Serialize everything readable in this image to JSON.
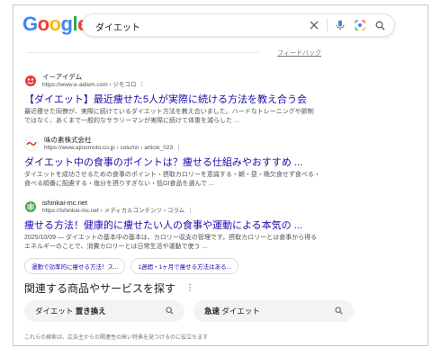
{
  "logo": {
    "letters": [
      "G",
      "o",
      "o",
      "g",
      "l",
      "e"
    ],
    "colors": [
      "#4285F4",
      "#EA4335",
      "#FBBC05",
      "#4285F4",
      "#34A853",
      "#EA4335"
    ]
  },
  "search": {
    "query": "ダイエット"
  },
  "feedback": "フィードバック",
  "results": [
    {
      "site_name": "イーアイデム",
      "url": "https://www.e-aidem.com › ジモコロ",
      "title": "【ダイエット】最近痩せた5人が実際に続ける方法を教え合う会",
      "snippet_1": "最近痩せた同僚が、実際に続けているダイエット方法を教え合いました。ハードなトレーニングや節制",
      "snippet_2": "ではなく、あくまで一般的なサラリーマンが実際に続けて体重を減らした ...",
      "favicon_color": "#e53935"
    },
    {
      "site_name": "味の素株式会社",
      "url": "https://www.ajinomoto.co.jp › column › article_023",
      "title": "ダイエット中の食事のポイントは？痩せる仕組みやおすすめ ...",
      "snippet_1": "ダイエットを成功させるための食事のポイント・摂取カロリーを意識する・朝・昼・晩欠食せず食べる・",
      "snippet_2": "食べる順番に配慮する・塩分を摂りすぎない・低GI食品を選んで ...",
      "favicon_color": "#e53935"
    },
    {
      "site_name": "ishinkai-mc.net",
      "url": "https://ishinkai-mc.net › メディカルコンテンツ › コラム",
      "title": "痩せる方法！健康的に痩せたい人の食事や運動による本気の ...",
      "snippet_1": "2025/10/09 — ダイエットの基本中の基本は、カロリー収支の管理です。摂取カロリーとは食事から得る",
      "snippet_2": "エネルギーのことで、消費カロリーとは日常生活や運動で使う ...",
      "favicon_color": "#43a047",
      "chips": [
        "運動で効率的に痩せる方法！ス...",
        "1週間・1ヶ月で痩せる方法はある..."
      ]
    }
  ],
  "related": {
    "title": "関連する商品やサービスを探す",
    "items": [
      {
        "plain": "ダイエット",
        "bold": "置き換え"
      },
      {
        "bold": "急速",
        "plain": "ダイエット"
      }
    ]
  },
  "footnote": "これらの検索は、広告主からの関連性の高い特典を見つけるのに役立ちます"
}
